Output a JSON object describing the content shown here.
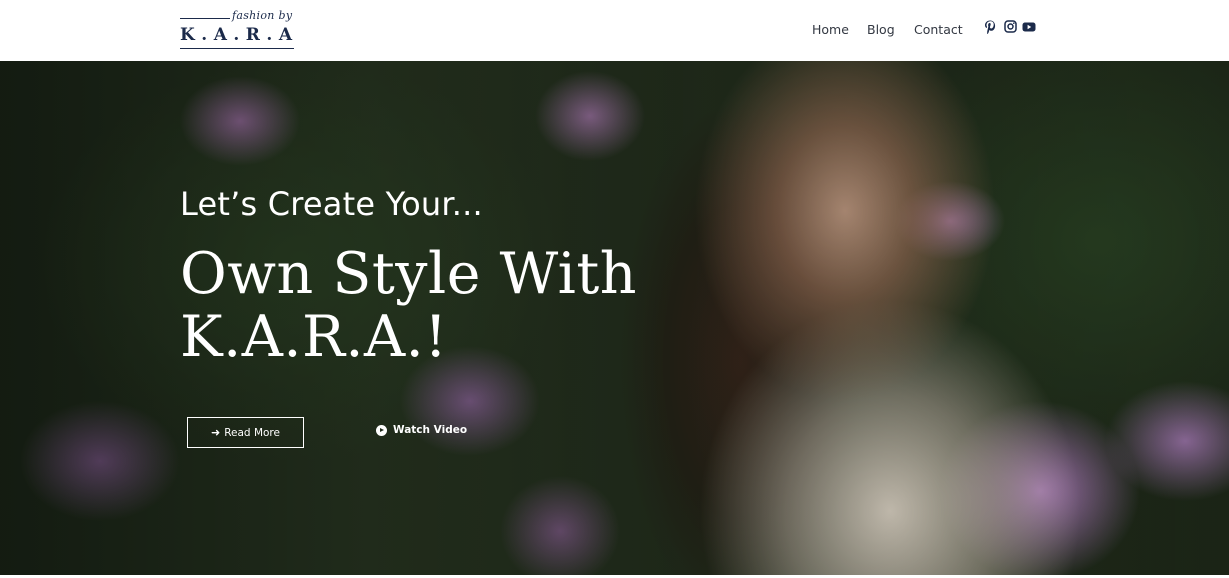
{
  "brand": {
    "script": "fashion by",
    "name": "K.A.R.A"
  },
  "nav": {
    "items": [
      "Home",
      "Blog",
      "Contact"
    ]
  },
  "social": {
    "icons": [
      "pinterest-icon",
      "instagram-icon",
      "youtube-icon"
    ]
  },
  "hero": {
    "subtitle": "Let’s Create Your...",
    "title": "Own Style With K.A.R.A.!",
    "read_more": "Read More",
    "watch_video": "Watch Video"
  },
  "colors": {
    "brand_navy": "#1b2a4a",
    "nav_text": "#333842",
    "hero_text": "#ffffff"
  }
}
